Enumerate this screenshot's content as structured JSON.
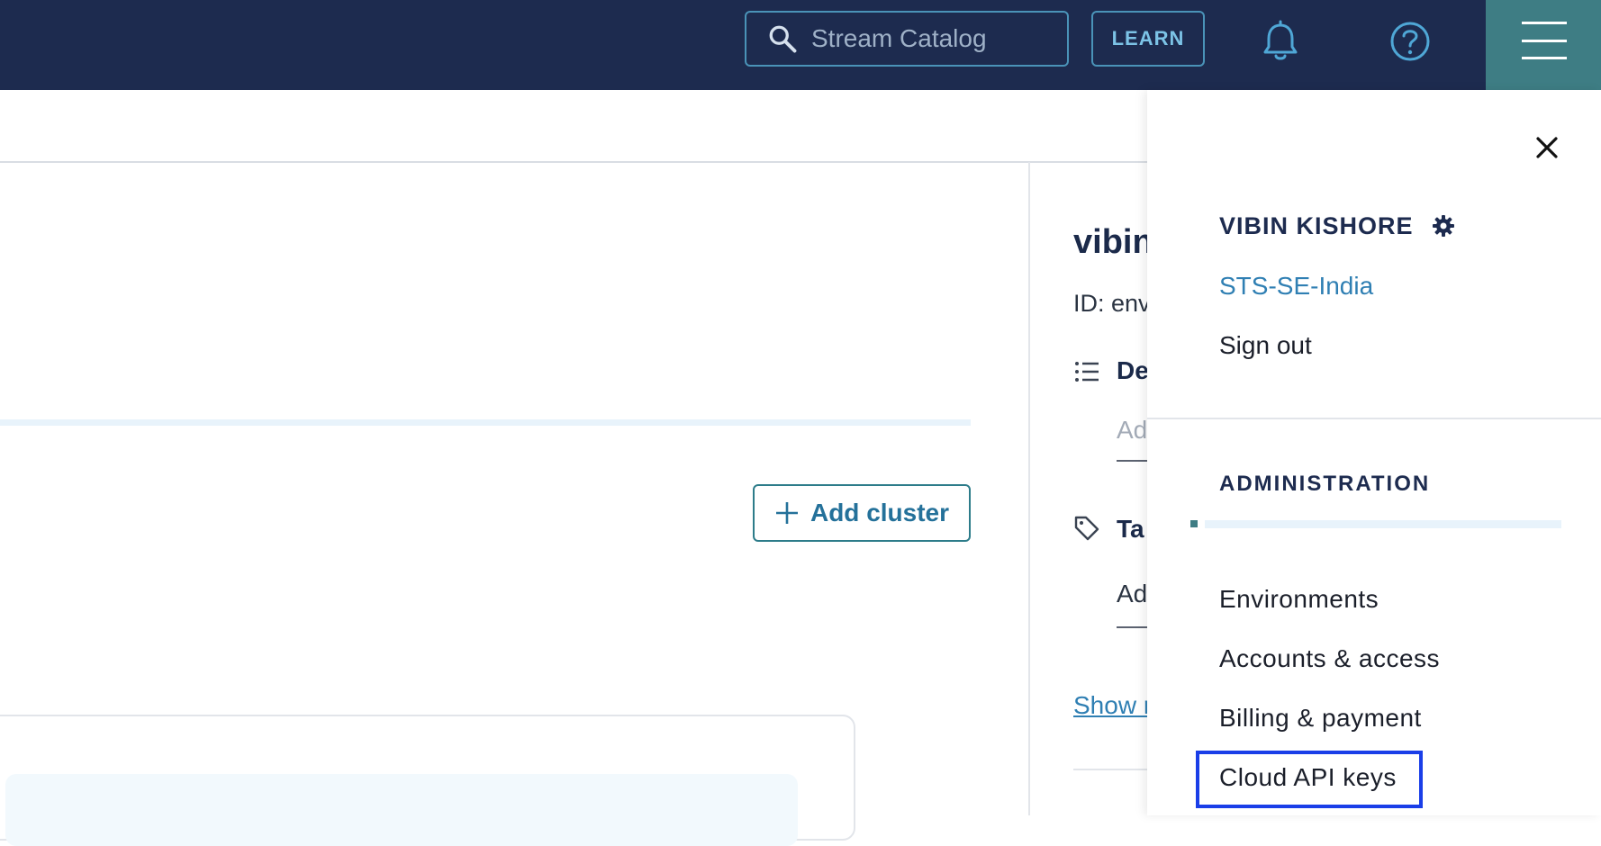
{
  "topbar": {
    "search": {
      "placeholder": "Stream Catalog",
      "icon": "search-icon"
    },
    "learn_label": "LEARN",
    "notification_icon": "bell-icon",
    "help_icon": "help-circle-icon",
    "menu_icon": "hamburger-menu-icon"
  },
  "main": {
    "add_cluster_label": "Add cluster",
    "environment": {
      "name": "vibin",
      "id_text": "ID: env",
      "description_label": "De",
      "description_placeholder": "Ad",
      "tags_label": "Ta",
      "tags_placeholder": "Ad",
      "show_more_label": "Show r"
    }
  },
  "side_menu": {
    "user_name": "VIBIN KISHORE",
    "org_name": "STS-SE-India",
    "sign_out_label": "Sign out",
    "section_title": "ADMINISTRATION",
    "items": [
      {
        "label": "Environments"
      },
      {
        "label": "Accounts & access"
      },
      {
        "label": "Billing & payment"
      },
      {
        "label": "Cloud API keys"
      }
    ],
    "highlighted_item": "Cloud API keys"
  },
  "colors": {
    "topbar_bg": "#1d2b4f",
    "menu_button_bg": "#3e7d84",
    "accent_link": "#2f7fb3",
    "highlight_border": "#1a3ee8"
  }
}
